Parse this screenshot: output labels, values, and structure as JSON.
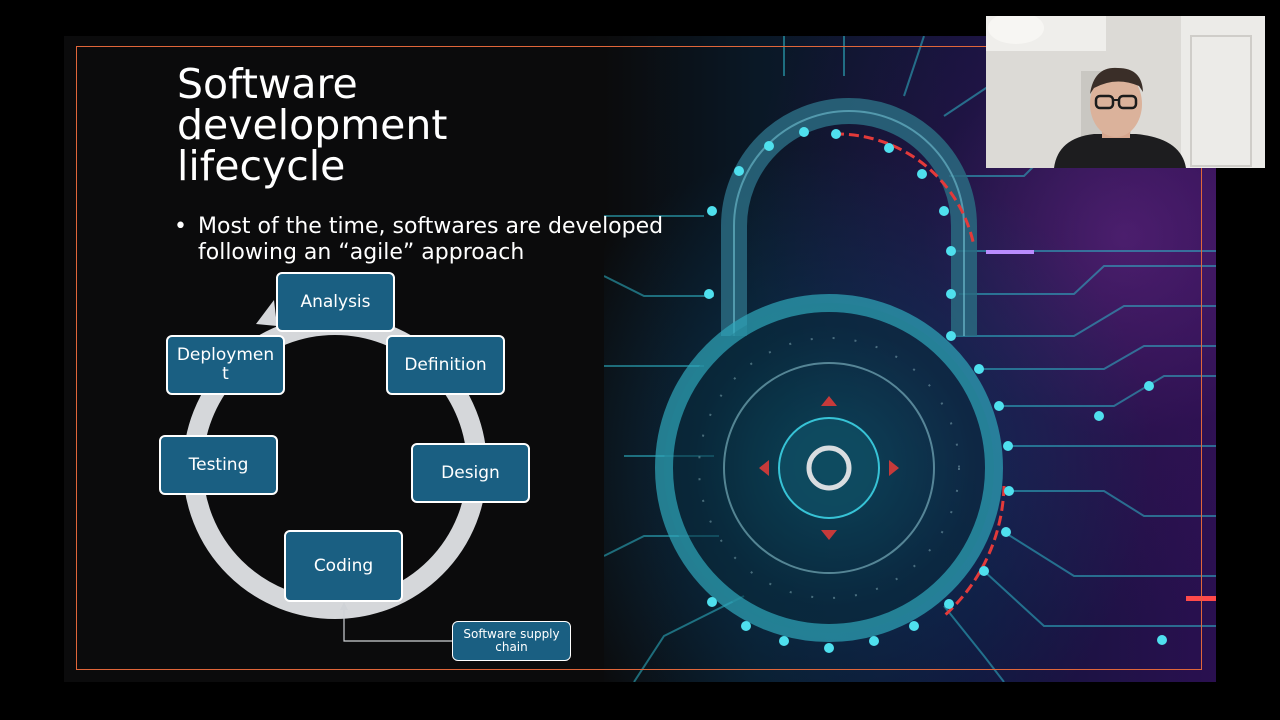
{
  "slide": {
    "title": "Software\ndevelopment\nlifecycle",
    "bullet_marker": "•",
    "bullet_text": "Most of the time, softwares are developed following an “agile” approach",
    "frame_color": "#e0663a"
  },
  "cycle": {
    "nodes": [
      {
        "id": "analysis",
        "label": "Analysis"
      },
      {
        "id": "definition",
        "label": "Definition"
      },
      {
        "id": "design",
        "label": "Design"
      },
      {
        "id": "coding",
        "label": "Coding"
      },
      {
        "id": "testing",
        "label": "Testing"
      },
      {
        "id": "deployment",
        "label": "Deploymen\nt"
      }
    ],
    "supply_chain_label": "Software supply chain",
    "node_color": "#1a5f82"
  },
  "art": {
    "icon": "padlock-circuit-image"
  },
  "webcam": {
    "icon": "presenter-video"
  }
}
